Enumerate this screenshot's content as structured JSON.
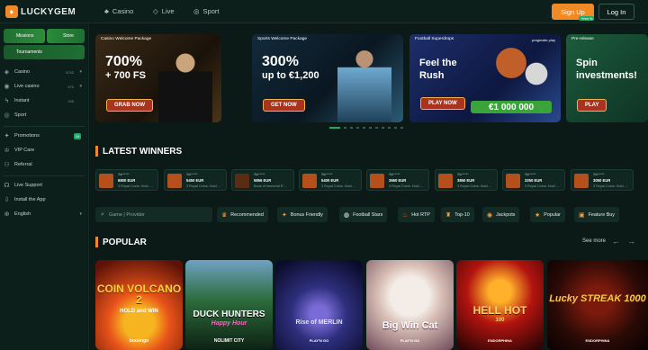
{
  "brand": {
    "name": "LUCKYGEM"
  },
  "topnav": {
    "tabs": [
      {
        "label": "Casino",
        "icon": "cards-icon"
      },
      {
        "label": "Live",
        "icon": "diamond-icon"
      },
      {
        "label": "Sport",
        "icon": "globe-icon"
      }
    ],
    "signup_label": "Sign Up",
    "signup_badge": "+free fs",
    "login_label": "Log In"
  },
  "sidebar": {
    "tiles": {
      "missions": "Missions",
      "store": "Store",
      "tournaments": "Tournaments"
    },
    "items": [
      {
        "label": "Casino",
        "count": "5742",
        "icon": "casino-icon",
        "chevron": true
      },
      {
        "label": "Live casino",
        "count": "472",
        "icon": "live-icon",
        "chevron": true
      },
      {
        "label": "Instant",
        "count": "249",
        "icon": "bolt-icon",
        "chevron": false
      },
      {
        "label": "Sport",
        "count": "",
        "icon": "globe-icon",
        "chevron": false
      },
      {
        "label": "Promotions",
        "count": "",
        "icon": "gift-icon",
        "badge": "19"
      },
      {
        "label": "VIP Care",
        "icon": "crown-icon"
      },
      {
        "label": "Referral",
        "icon": "users-icon"
      },
      {
        "label": "Live Support",
        "icon": "headset-icon"
      },
      {
        "label": "Install the App",
        "icon": "download-icon"
      },
      {
        "label": "English",
        "icon": "language-icon",
        "chevron": true
      }
    ]
  },
  "banners": [
    {
      "tag": "Casino Welcome Package",
      "line1": "700%",
      "line2": "+ 700 FS",
      "cta": "GRAB NOW"
    },
    {
      "tag": "Sports Welcome Package",
      "line1": "300%",
      "line2": "up to €1,200",
      "cta": "GET NOW"
    },
    {
      "tag": "Football Superdrops",
      "line1": "Feel the",
      "line2": "Rush",
      "cta": "PLAY NOW",
      "prize": "€1 000 000",
      "brand": "pragmatic play"
    },
    {
      "tag": "Pre-release",
      "line1": "Spin",
      "line2": "investments!",
      "cta": "PLAY"
    }
  ],
  "latest_winners": {
    "title": "LATEST WINNERS",
    "items": [
      {
        "user": "Ski*****",
        "amount": "6800 EUR",
        "game": "3 Royal Coins: Hold ..."
      },
      {
        "user": "Ski*****",
        "amount": "5450 EUR",
        "game": "3 Royal Coins: Hold ..."
      },
      {
        "user": "Ski*****",
        "amount": "5856 EUR",
        "game": "Book of Immortal R..."
      },
      {
        "user": "Ski*****",
        "amount": "5400 EUR",
        "game": "3 Royal Coins: Hold ..."
      },
      {
        "user": "Ski*****",
        "amount": "3660 EUR",
        "game": "3 Royal Coins: Hold ..."
      },
      {
        "user": "Ski*****",
        "amount": "3850 EUR",
        "game": "3 Royal Coins: Hold ..."
      },
      {
        "user": "Ski*****",
        "amount": "3250 EUR",
        "game": "3 Royal Coins: Hold ..."
      },
      {
        "user": "Ski*****",
        "amount": "3050 EUR",
        "game": "3 Royal Coins: Hold ..."
      }
    ]
  },
  "search": {
    "placeholder": "Game | Provider"
  },
  "categories": [
    {
      "label": "Recommended",
      "icon": "thumb-icon"
    },
    {
      "label": "Bonus Friendly",
      "icon": "gift-icon"
    },
    {
      "label": "Football Stars",
      "icon": "football-icon"
    },
    {
      "label": "Hot RTP",
      "icon": "fire-icon"
    },
    {
      "label": "Top-10",
      "icon": "trophy-icon"
    },
    {
      "label": "Jackpots",
      "icon": "coins-icon"
    },
    {
      "label": "Popular",
      "icon": "star-icon"
    },
    {
      "label": "Feature Buy",
      "icon": "cart-icon"
    }
  ],
  "popular": {
    "title": "POPULAR",
    "see_more": "See more",
    "games": [
      {
        "title": "COIN VOLCANO 2",
        "subtitle": "HOLD and WIN",
        "provider": "booongo",
        "colors": [
          "#e8531a",
          "#5c1208"
        ]
      },
      {
        "title": "DUCK HUNTERS",
        "subtitle": "Happy Hour",
        "provider": "NOLIMIT CITY",
        "colors": [
          "#2c6b3b",
          "#0e2214"
        ]
      },
      {
        "title": "Rise of MERLIN",
        "subtitle": "",
        "provider": "PLAY'N GO",
        "colors": [
          "#2d2f7d",
          "#0b0c2a"
        ]
      },
      {
        "title": "Big Win Cat",
        "subtitle": "",
        "provider": "PLAY'N GO",
        "colors": [
          "#d9c0b6",
          "#6f4a5a"
        ]
      },
      {
        "title": "HELL HOT",
        "subtitle": "100",
        "provider": "ENDORPHINA",
        "colors": [
          "#b3140f",
          "#2a0504"
        ]
      },
      {
        "title": "Lucky STREAK 1000",
        "subtitle": "",
        "provider": "ENDORPHINA",
        "colors": [
          "#2a0a06",
          "#090202"
        ]
      }
    ]
  },
  "colors": {
    "accent": "#f08a24",
    "green": "#1fa868",
    "bg": "#0b1a16"
  }
}
